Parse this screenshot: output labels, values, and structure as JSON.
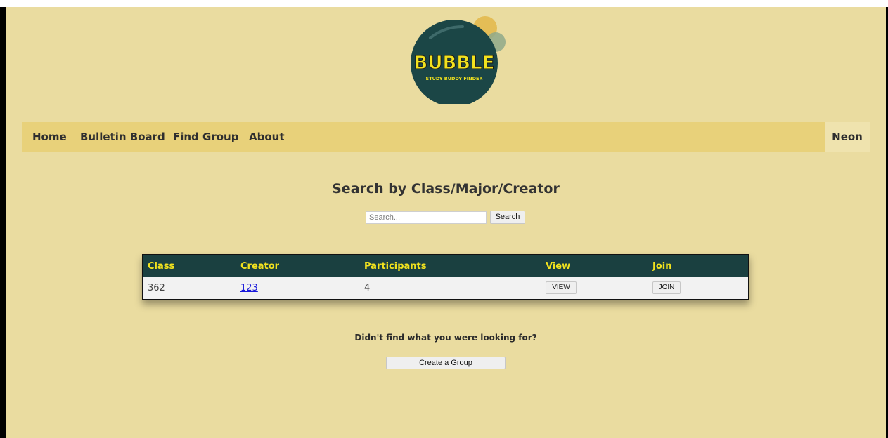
{
  "logo": {
    "title": "BUBBLE",
    "subtitle": "STUDY BUDDY FINDER"
  },
  "nav": {
    "items": [
      {
        "label": "Home"
      },
      {
        "label": "Bulletin Board"
      },
      {
        "label": "Find Group"
      },
      {
        "label": "About"
      }
    ],
    "user": "Neon"
  },
  "search": {
    "heading": "Search by Class/Major/Creator",
    "placeholder": "Search...",
    "button_label": "Search"
  },
  "table": {
    "headers": [
      "Class",
      "Creator",
      "Participants",
      "View",
      "Join"
    ],
    "rows": [
      {
        "class": "362",
        "creator": "123",
        "participants": "4",
        "view_label": "VIEW",
        "join_label": "JOIN"
      }
    ]
  },
  "footer": {
    "prompt": "Didn't find what you were looking for?",
    "create_label": "Create a Group"
  },
  "colors": {
    "page_bg": "#eadca0",
    "nav_bg": "#e8d17a",
    "table_header_bg": "#1a4040",
    "table_header_text": "#f2e21e",
    "logo_bubble": "#1b4646"
  }
}
